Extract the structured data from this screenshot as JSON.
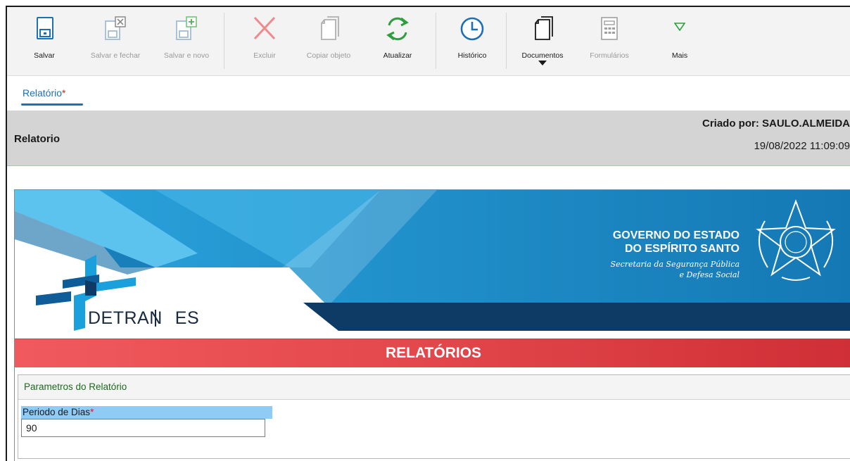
{
  "toolbar": {
    "items": [
      {
        "label": "Salvar",
        "icon": "save-icon",
        "enabled": true
      },
      {
        "label": "Salvar e fechar",
        "icon": "save-close-icon",
        "enabled": false
      },
      {
        "label": "Salvar e novo",
        "icon": "save-new-icon",
        "enabled": false
      },
      {
        "label": "Excluir",
        "icon": "delete-icon",
        "enabled": false
      },
      {
        "label": "Copiar objeto",
        "icon": "copy-icon",
        "enabled": false
      },
      {
        "label": "Atualizar",
        "icon": "refresh-icon",
        "enabled": true
      },
      {
        "label": "Histórico",
        "icon": "clock-icon",
        "enabled": true
      },
      {
        "label": "Documentos",
        "icon": "documents-icon",
        "enabled": true
      },
      {
        "label": "Formulários",
        "icon": "forms-icon",
        "enabled": false
      },
      {
        "label": "Mais",
        "icon": "chevron-down-icon",
        "enabled": true
      }
    ]
  },
  "tab": {
    "label": "Relatório",
    "required_mark": "*"
  },
  "header": {
    "title": "Relatorio",
    "created_by": "Criado por: SAULO.ALMEIDA",
    "created_at": "19/08/2022 11:09:09"
  },
  "banner": {
    "gov_line1": "GOVERNO DO ESTADO",
    "gov_line2": "DO ESPÍRITO SANTO",
    "sec_line1": "Secretaria da Segurança Pública",
    "sec_line2": "e Defesa Social",
    "logo_left": "DETRAN",
    "logo_right": "ES"
  },
  "section_title": "RELATÓRIOS",
  "params": {
    "title": "Parametros do Relatório",
    "field_label": "Periodo de Dias",
    "required_mark": "*",
    "field_value": "90"
  },
  "colors": {
    "accent_blue": "#1f6fb5",
    "green": "#2e9e3e",
    "red_bar": "#e2474b",
    "banner_blue": "#1c8fca",
    "banner_navy": "#0e3a66",
    "label_bg": "#8ecbf5"
  }
}
